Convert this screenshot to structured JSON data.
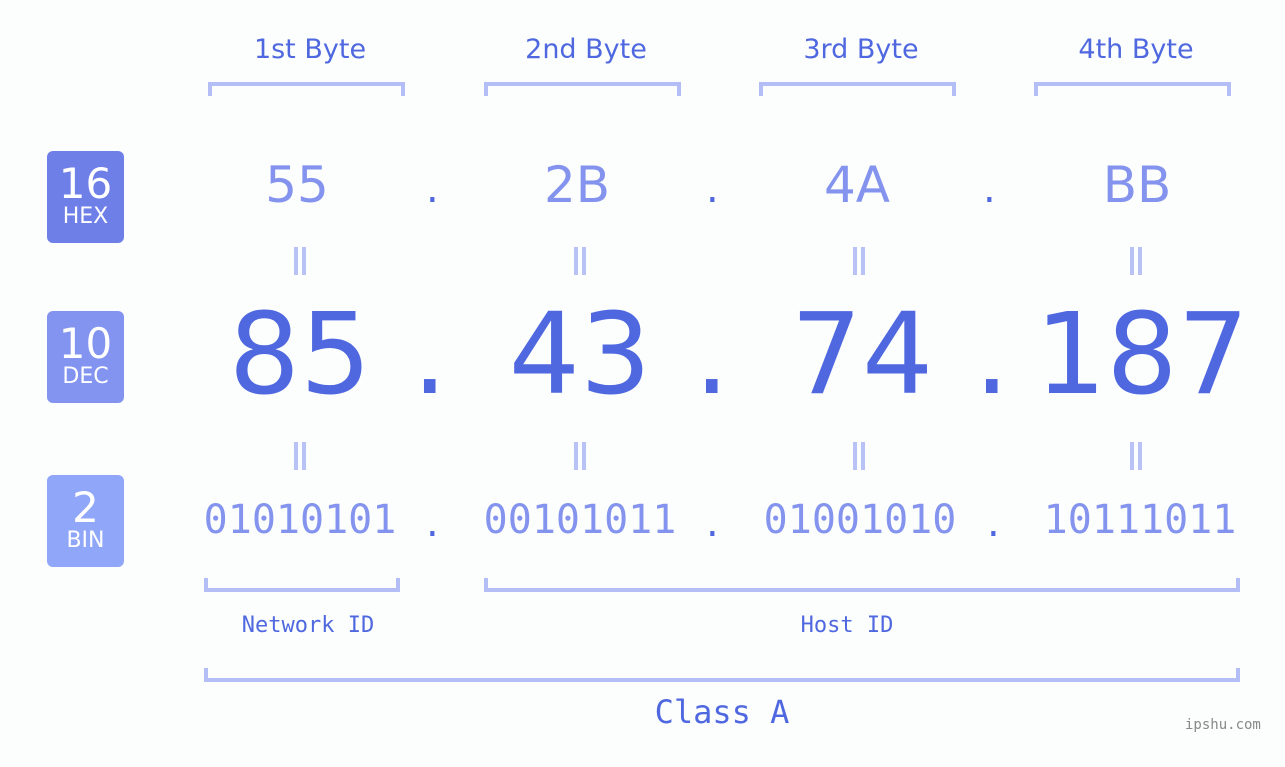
{
  "bytes": [
    {
      "label": "1st Byte",
      "hex": "55",
      "dec": "85",
      "bin": "01010101"
    },
    {
      "label": "2nd Byte",
      "hex": "2B",
      "dec": "43",
      "bin": "00101011"
    },
    {
      "label": "3rd Byte",
      "hex": "4A",
      "dec": "74",
      "bin": "01001010"
    },
    {
      "label": "4th Byte",
      "hex": "BB",
      "dec": "187",
      "bin": "10111011"
    }
  ],
  "separator": ".",
  "badges": {
    "hex": {
      "num": "16",
      "label": "HEX",
      "color": "#6f7fe8"
    },
    "dec": {
      "num": "10",
      "label": "DEC",
      "color": "#8394f0"
    },
    "bin": {
      "num": "2",
      "label": "BIN",
      "color": "#90a6f8"
    }
  },
  "network_id_label": "Network ID",
  "host_id_label": "Host ID",
  "class_label": "Class A",
  "watermark": "ipshu.com"
}
